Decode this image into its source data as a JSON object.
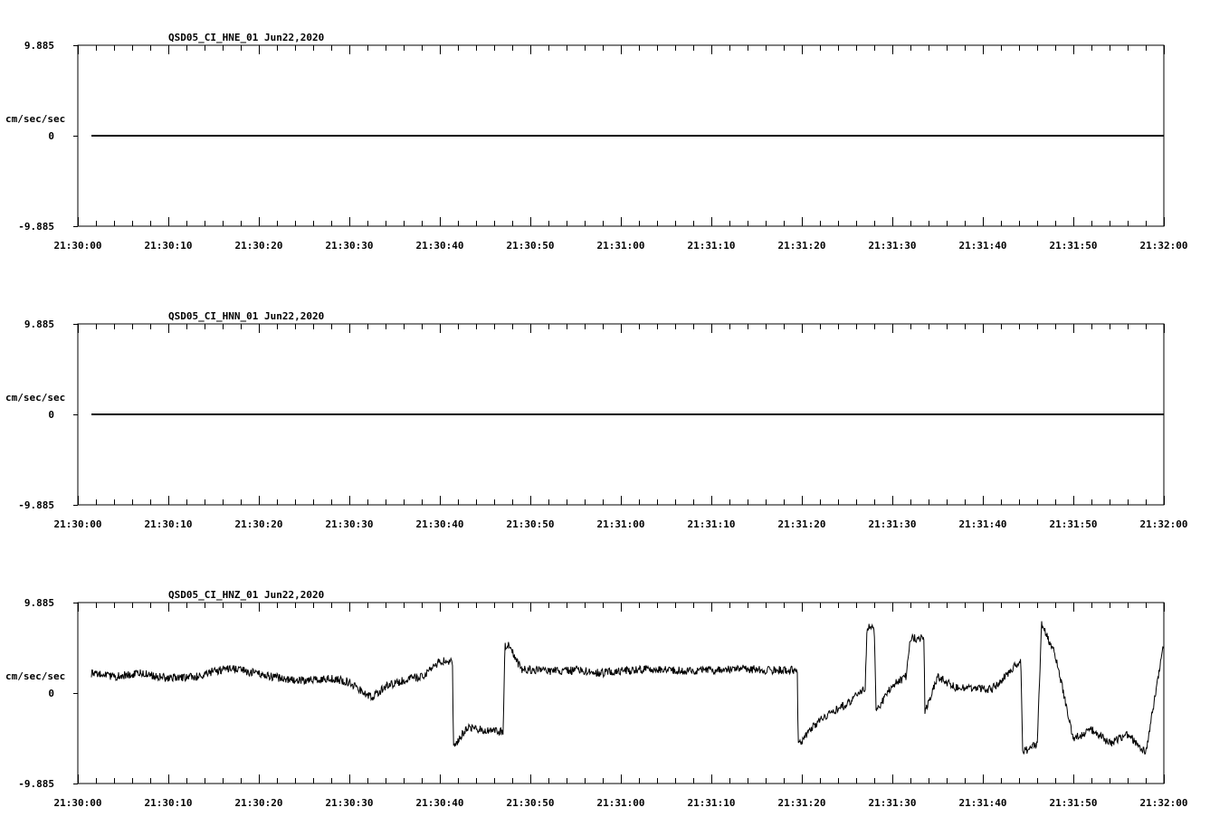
{
  "chart_data": [
    {
      "type": "line",
      "title": "QSD05_CI_HNE_01  Jun22,2020",
      "ylabel": "cm/sec/sec",
      "ytick_labels": [
        "9.885",
        "0",
        "-9.885"
      ],
      "ylim": [
        -9.885,
        9.885
      ],
      "xlim": [
        "21:30:00",
        "21:32:00"
      ],
      "xtick_labels": [
        "21:30:00",
        "21:30:10",
        "21:30:20",
        "21:30:30",
        "21:30:40",
        "21:30:50",
        "21:31:00",
        "21:31:10",
        "21:31:20",
        "21:31:30",
        "21:31:40",
        "21:31:50",
        "21:32:00"
      ],
      "series": [
        {
          "x": [
            "21:30:01.5",
            "21:32:00"
          ],
          "values": [
            0,
            0
          ],
          "color": "#000000"
        }
      ]
    },
    {
      "type": "line",
      "title": "QSD05_CI_HNN_01  Jun22,2020",
      "ylabel": "cm/sec/sec",
      "ytick_labels": [
        "9.885",
        "0",
        "-9.885"
      ],
      "ylim": [
        -9.885,
        9.885
      ],
      "xlim": [
        "21:30:00",
        "21:32:00"
      ],
      "xtick_labels": [
        "21:30:00",
        "21:30:10",
        "21:30:20",
        "21:30:30",
        "21:30:40",
        "21:30:50",
        "21:31:00",
        "21:31:10",
        "21:31:20",
        "21:31:30",
        "21:31:40",
        "21:31:50",
        "21:32:00"
      ],
      "series": [
        {
          "x": [
            "21:30:01.5",
            "21:32:00"
          ],
          "values": [
            0,
            0
          ],
          "color": "#000000"
        }
      ]
    },
    {
      "type": "line",
      "title": "QSD05_CI_HNZ_01  Jun22,2020",
      "ylabel": "cm/sec/sec",
      "ytick_labels": [
        "9.885",
        "0",
        "-9.885"
      ],
      "ylim": [
        -9.885,
        9.885
      ],
      "xlim": [
        "21:30:00",
        "21:32:00"
      ],
      "xtick_labels": [
        "21:30:00",
        "21:30:10",
        "21:30:20",
        "21:30:30",
        "21:30:40",
        "21:30:50",
        "21:31:00",
        "21:31:10",
        "21:31:20",
        "21:31:30",
        "21:31:40",
        "21:31:50",
        "21:32:00"
      ],
      "series": [
        {
          "color": "#000000",
          "x": [
            "21:30:01.5",
            "21:30:04",
            "21:30:07",
            "21:30:10",
            "21:30:13",
            "21:30:15",
            "21:30:17",
            "21:30:19",
            "21:30:22",
            "21:30:25",
            "21:30:28",
            "21:30:30",
            "21:30:32.5",
            "21:30:34",
            "21:30:36",
            "21:30:38",
            "21:30:40",
            "21:30:41.4",
            "21:30:41.5",
            "21:30:43",
            "21:30:45",
            "21:30:47",
            "21:30:47.2",
            "21:30:47.6",
            "21:30:49",
            "21:30:52",
            "21:30:55",
            "21:30:58",
            "21:31:01",
            "21:31:04",
            "21:31:07",
            "21:31:10",
            "21:31:13",
            "21:31:16",
            "21:31:19.5",
            "21:31:19.6",
            "21:31:22",
            "21:31:25",
            "21:31:27",
            "21:31:27.2",
            "21:31:28",
            "21:31:28.2",
            "21:31:30",
            "21:31:31.5",
            "21:31:32",
            "21:31:33.5",
            "21:31:33.6",
            "21:31:35",
            "21:31:37",
            "21:31:39",
            "21:31:41",
            "21:31:44.2",
            "21:31:44.4",
            "21:31:46",
            "21:31:46.5",
            "21:31:48",
            "21:31:50",
            "21:31:52",
            "21:31:54",
            "21:31:56",
            "21:31:58",
            "21:32:00"
          ],
          "values": [
            2.1,
            1.8,
            2.2,
            1.6,
            1.8,
            2.4,
            2.7,
            2.3,
            1.7,
            1.3,
            1.6,
            1.2,
            -0.5,
            0.7,
            1.4,
            1.8,
            3.5,
            3.4,
            -6.0,
            -3.8,
            -4.0,
            -4.2,
            5.2,
            5.3,
            2.6,
            2.4,
            2.5,
            2.2,
            2.5,
            2.6,
            2.4,
            2.5,
            2.7,
            2.5,
            2.5,
            -5.8,
            -2.8,
            -1.2,
            0.5,
            7.2,
            7.0,
            -2.0,
            0.8,
            1.8,
            6.0,
            6.0,
            -2.0,
            1.8,
            0.6,
            0.5,
            0.4,
            3.6,
            -6.5,
            -5.5,
            7.5,
            4.2,
            -5.0,
            -4.0,
            -5.5,
            -4.5,
            -6.5,
            5.5
          ]
        }
      ]
    }
  ]
}
